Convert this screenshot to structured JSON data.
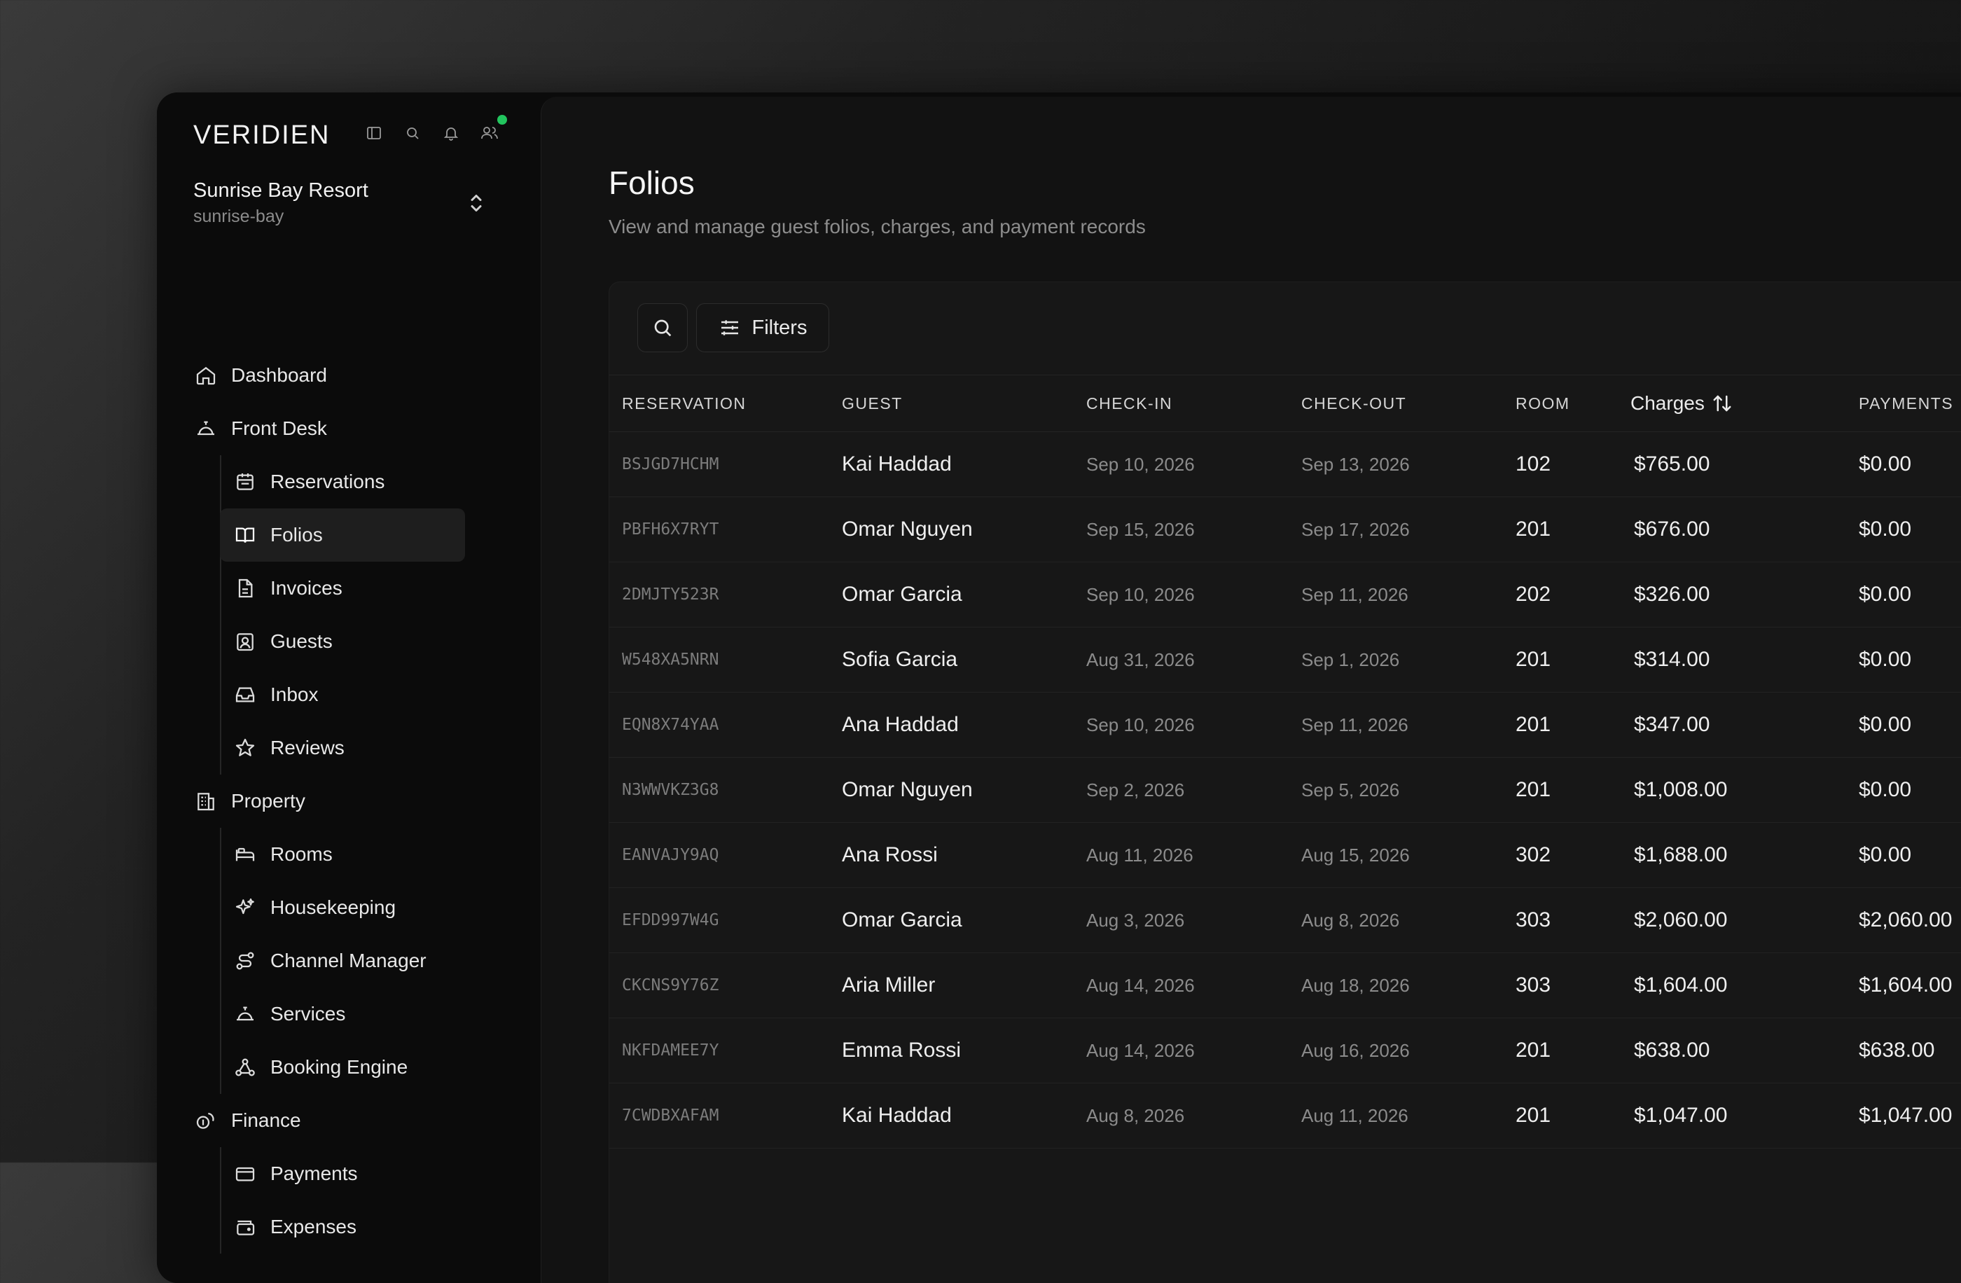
{
  "app": {
    "logo": "VERIDIEN"
  },
  "property": {
    "name": "Sunrise Bay Resort",
    "slug": "sunrise-bay"
  },
  "sidebar": {
    "items": [
      {
        "label": "Dashboard",
        "icon": "home-icon",
        "level": 0
      },
      {
        "label": "Front Desk",
        "icon": "concierge-bell-icon",
        "level": 0
      },
      {
        "label": "Reservations",
        "icon": "calendar-icon",
        "level": 1
      },
      {
        "label": "Folios",
        "icon": "book-open-icon",
        "level": 1,
        "active": true
      },
      {
        "label": "Invoices",
        "icon": "file-text-icon",
        "level": 1
      },
      {
        "label": "Guests",
        "icon": "contact-icon",
        "level": 1
      },
      {
        "label": "Inbox",
        "icon": "inbox-icon",
        "level": 1
      },
      {
        "label": "Reviews",
        "icon": "star-icon",
        "level": 1
      },
      {
        "label": "Property",
        "icon": "building-icon",
        "level": 0
      },
      {
        "label": "Rooms",
        "icon": "bed-icon",
        "level": 1
      },
      {
        "label": "Housekeeping",
        "icon": "sparkles-icon",
        "level": 1
      },
      {
        "label": "Channel Manager",
        "icon": "route-icon",
        "level": 1
      },
      {
        "label": "Services",
        "icon": "concierge-bell-icon",
        "level": 1
      },
      {
        "label": "Booking Engine",
        "icon": "webhook-icon",
        "level": 1
      },
      {
        "label": "Finance",
        "icon": "coins-icon",
        "level": 0
      },
      {
        "label": "Payments",
        "icon": "credit-card-icon",
        "level": 1
      },
      {
        "label": "Expenses",
        "icon": "wallet-icon",
        "level": 1
      }
    ]
  },
  "page": {
    "title": "Folios",
    "subtitle": "View and manage guest folios, charges, and payment records"
  },
  "toolbar": {
    "filters_label": "Filters"
  },
  "table": {
    "columns": [
      "RESERVATION",
      "GUEST",
      "CHECK-IN",
      "CHECK-OUT",
      "ROOM",
      "Charges",
      "PAYMENTS"
    ],
    "rows": [
      {
        "reservation": "BSJGD7HCHM",
        "guest": "Kai Haddad",
        "check_in": "Sep 10, 2026",
        "check_out": "Sep 13, 2026",
        "room": "102",
        "charges": "$765.00",
        "payments": "$0.00"
      },
      {
        "reservation": "PBFH6X7RYT",
        "guest": "Omar Nguyen",
        "check_in": "Sep 15, 2026",
        "check_out": "Sep 17, 2026",
        "room": "201",
        "charges": "$676.00",
        "payments": "$0.00"
      },
      {
        "reservation": "2DMJTY523R",
        "guest": "Omar Garcia",
        "check_in": "Sep 10, 2026",
        "check_out": "Sep 11, 2026",
        "room": "202",
        "charges": "$326.00",
        "payments": "$0.00"
      },
      {
        "reservation": "W548XA5NRN",
        "guest": "Sofia Garcia",
        "check_in": "Aug 31, 2026",
        "check_out": "Sep 1, 2026",
        "room": "201",
        "charges": "$314.00",
        "payments": "$0.00"
      },
      {
        "reservation": "EQN8X74YAA",
        "guest": "Ana Haddad",
        "check_in": "Sep 10, 2026",
        "check_out": "Sep 11, 2026",
        "room": "201",
        "charges": "$347.00",
        "payments": "$0.00"
      },
      {
        "reservation": "N3WWVKZ3G8",
        "guest": "Omar Nguyen",
        "check_in": "Sep 2, 2026",
        "check_out": "Sep 5, 2026",
        "room": "201",
        "charges": "$1,008.00",
        "payments": "$0.00"
      },
      {
        "reservation": "EANVAJY9AQ",
        "guest": "Ana Rossi",
        "check_in": "Aug 11, 2026",
        "check_out": "Aug 15, 2026",
        "room": "302",
        "charges": "$1,688.00",
        "payments": "$0.00"
      },
      {
        "reservation": "EFDD997W4G",
        "guest": "Omar Garcia",
        "check_in": "Aug 3, 2026",
        "check_out": "Aug 8, 2026",
        "room": "303",
        "charges": "$2,060.00",
        "payments": "$2,060.00"
      },
      {
        "reservation": "CKCNS9Y76Z",
        "guest": "Aria Miller",
        "check_in": "Aug 14, 2026",
        "check_out": "Aug 18, 2026",
        "room": "303",
        "charges": "$1,604.00",
        "payments": "$1,604.00"
      },
      {
        "reservation": "NKFDAMEE7Y",
        "guest": "Emma Rossi",
        "check_in": "Aug 14, 2026",
        "check_out": "Aug 16, 2026",
        "room": "201",
        "charges": "$638.00",
        "payments": "$638.00"
      },
      {
        "reservation": "7CWDBXAFAM",
        "guest": "Kai Haddad",
        "check_in": "Aug 8, 2026",
        "check_out": "Aug 11, 2026",
        "room": "201",
        "charges": "$1,047.00",
        "payments": "$1,047.00"
      }
    ]
  },
  "colors": {
    "accent_status": "#22c55e",
    "background": "#0b0b0b",
    "panel": "#121212"
  }
}
